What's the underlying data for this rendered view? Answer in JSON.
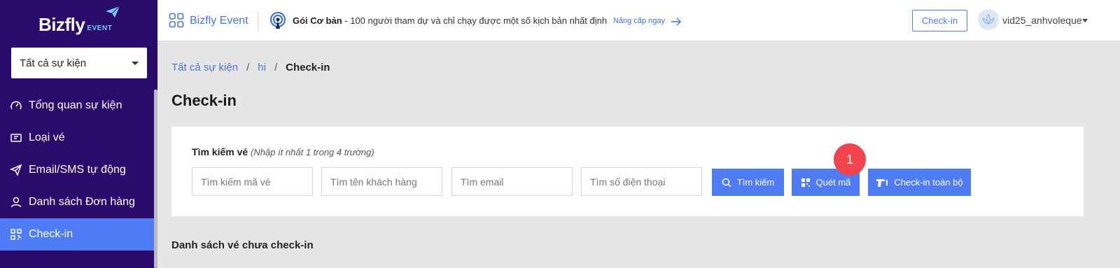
{
  "sidebar": {
    "logo": {
      "main": "Bizfly",
      "sub": "EVENT"
    },
    "event_select": {
      "value": "Tất cả sự kiện"
    },
    "items": [
      {
        "label": "Tổng quan sự kiện",
        "icon": "gauge-icon",
        "active": false
      },
      {
        "label": "Loại vé",
        "icon": "ticket-icon",
        "active": false
      },
      {
        "label": "Email/SMS tự động",
        "icon": "send-icon",
        "active": false
      },
      {
        "label": "Danh sách Đơn hàng",
        "icon": "user-icon",
        "active": false
      },
      {
        "label": "Check-in",
        "icon": "qr-code-icon",
        "active": true
      }
    ]
  },
  "header": {
    "app_name": "Bizfly Event",
    "plan_name": "Gói Cơ bản",
    "plan_description": " - 100 người tham dự và chỉ chạy được một số kịch bản nhất định",
    "upgrade_label": "Nâng cấp ngay",
    "checkin_button": "Check-in",
    "username": "vid25_anhvoleque"
  },
  "breadcrumb": {
    "items": [
      "Tất cả sự kiện",
      "hi"
    ],
    "separator": "/",
    "current": "Check-in"
  },
  "page": {
    "title": "Check-in"
  },
  "search": {
    "label": "Tìm kiếm vé",
    "hint": "(Nhập ít nhất 1 trong 4 trường)",
    "fields": [
      {
        "placeholder": "Tìm kiếm mã vé"
      },
      {
        "placeholder": "Tìm tên khách hàng"
      },
      {
        "placeholder": "Tìm email"
      },
      {
        "placeholder": "Tìm số điện thoại"
      }
    ],
    "buttons": {
      "search": "Tìm kiếm",
      "scan": "Quét mã",
      "checkin_all": "Check-in toàn bộ"
    },
    "badge": "1"
  },
  "list": {
    "title": "Danh sách vé chưa check-in"
  },
  "colors": {
    "sidebar_bg": "#2a0a6b",
    "accent": "#4f7cf4",
    "badge": "#f1444c"
  }
}
